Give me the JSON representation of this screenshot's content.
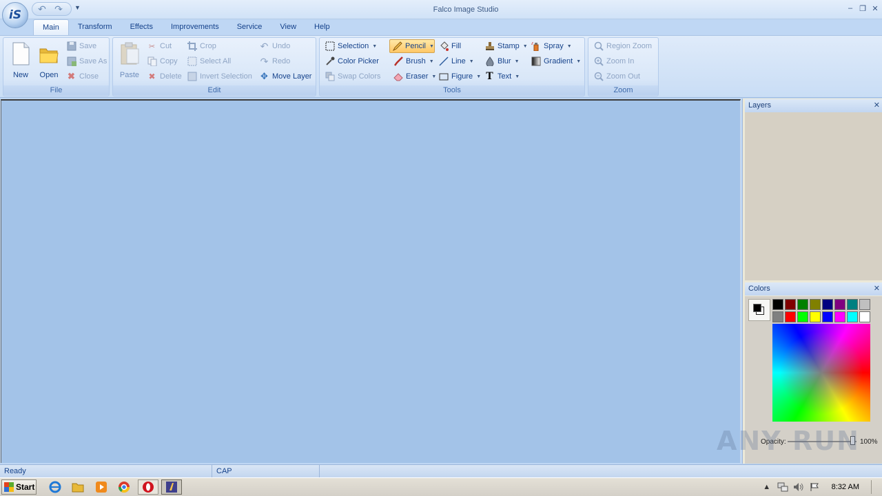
{
  "window": {
    "title": "Falco Image Studio",
    "app_logo_text": "iS",
    "menu_caret": "▼",
    "minimize": "‒",
    "restore": "❐",
    "close": "✕"
  },
  "tabs": [
    "Main",
    "Transform",
    "Effects",
    "Improvements",
    "Service",
    "View",
    "Help"
  ],
  "ribbon": {
    "file": {
      "label": "File",
      "new": "New",
      "open": "Open",
      "save": "Save",
      "save_as": "Save As",
      "close": "Close"
    },
    "edit": {
      "label": "Edit",
      "paste": "Paste",
      "cut": "Cut",
      "copy": "Copy",
      "delete": "Delete",
      "crop": "Crop",
      "select_all": "Select All",
      "invert_selection": "Invert Selection",
      "undo": "Undo",
      "redo": "Redo",
      "move_layer": "Move Layer"
    },
    "tools": {
      "label": "Tools",
      "selection": "Selection",
      "color_picker": "Color Picker",
      "swap_colors": "Swap Colors",
      "pencil": "Pencil",
      "brush": "Brush",
      "eraser": "Eraser",
      "fill": "Fill",
      "line": "Line",
      "figure": "Figure",
      "stamp": "Stamp",
      "blur": "Blur",
      "text": "Text",
      "spray": "Spray",
      "gradient": "Gradient"
    },
    "zoom": {
      "label": "Zoom",
      "region_zoom": "Region Zoom",
      "zoom_in": "Zoom In",
      "zoom_out": "Zoom Out"
    }
  },
  "panels": {
    "layers": {
      "title": "Layers",
      "close": "✕"
    },
    "colors": {
      "title": "Colors",
      "close": "✕",
      "primary": "#000000",
      "secondary": "#ffffff",
      "palette": [
        "#000000",
        "#800000",
        "#008000",
        "#808000",
        "#000080",
        "#800080",
        "#008080",
        "#c0c0c0",
        "#808080",
        "#ff0000",
        "#00ff00",
        "#ffff00",
        "#0000ff",
        "#ff00ff",
        "#00ffff",
        "#ffffff"
      ],
      "opacity_label": "Opacity:",
      "opacity_value": "100%"
    }
  },
  "status": {
    "state": "Ready",
    "caps": "CAP"
  },
  "taskbar": {
    "start": "Start",
    "time": "8:32 AM"
  },
  "watermark": "ANY RUN"
}
